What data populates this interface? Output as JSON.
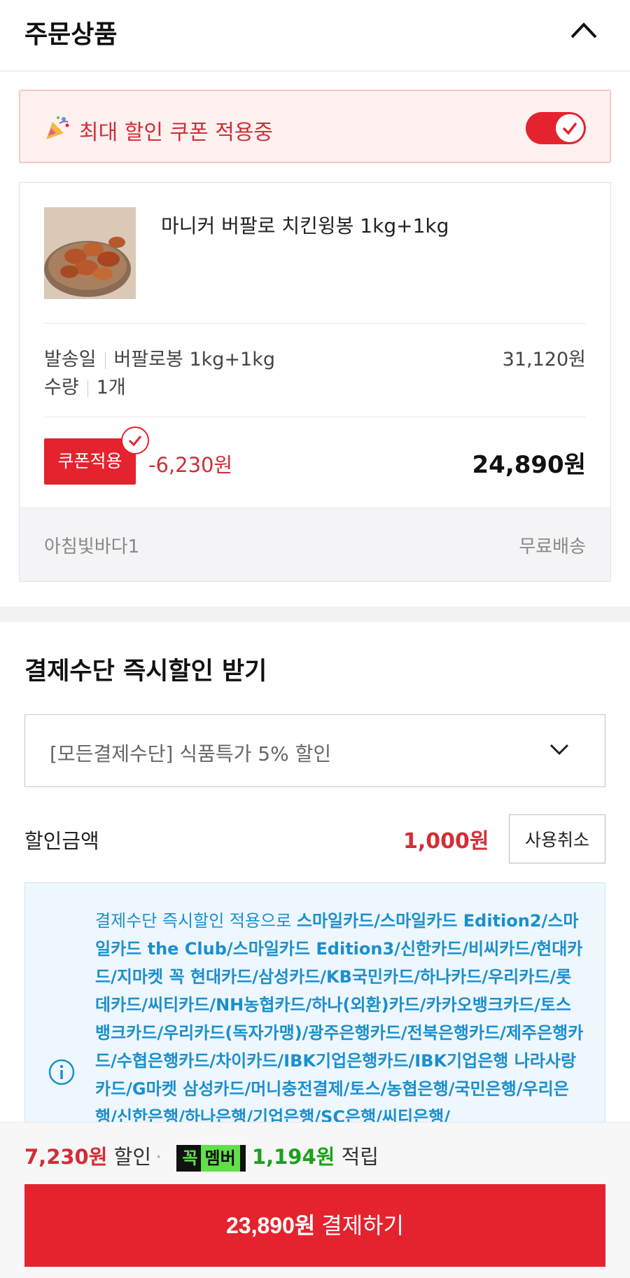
{
  "order_section": {
    "title": "주문상품"
  },
  "coupon_banner": {
    "emoji": "🎉",
    "label": "최대 할인 쿠폰 적용중",
    "toggle_on": true
  },
  "product": {
    "name": "마니커 버팔로 치킨윙봉 1kg+1kg",
    "ship_label": "발송일",
    "option": "버팔로봉 1kg+1kg",
    "qty_label": "수량",
    "qty_value": "1개",
    "original_price": "31,120원",
    "coupon_tag": "쿠폰적용",
    "coupon_discount": "-6,230원",
    "final_price": "24,890원",
    "seller": "아침빛바다1",
    "shipping": "무료배송"
  },
  "payment_discount": {
    "title": "결제수단 즉시할인 받기",
    "selected": "[모든결제수단] 식품특가 5% 할인",
    "amount_label": "할인금액",
    "amount": "1,000원",
    "cancel_label": "사용취소",
    "info_prefix": "결제수단 즉시할인 적용으로 ",
    "info_cards": "스마일카드/스마일카드 Edition2/스마일카드 the Club/스마일카드 Edition3/신한카드/비씨카드/현대카드/지마켓 꼭 현대카드/삼성카드/KB국민카드/하나카드/우리카드/롯데카드/씨티카드/NH농협카드/하나(외환)카드/카카오뱅크카드/토스뱅크카드/우리카드(독자가맹)/광주은행카드/전북은행카드/제주은행카드/수협은행카드/차이카드/IBK기업은행카드/IBK기업은행 나라사랑카드/G마켓 삼성카드/머니충전결제/토스/농협은행/국민은행/우리은행/신한은행/하나은행/기업은행/SC은행/씨티은행/"
  },
  "bottom_bar": {
    "discount_total": "7,230원",
    "discount_word": "할인",
    "dot": "·",
    "badge_k": "꼭",
    "badge_m": "멤버",
    "points": "1,194원",
    "points_word": "적립",
    "pay_amount": "23,890원",
    "pay_word": "결제하기"
  },
  "colors": {
    "accent": "#e4232f",
    "info": "#1a8fcf",
    "member_green": "#61e04a"
  }
}
